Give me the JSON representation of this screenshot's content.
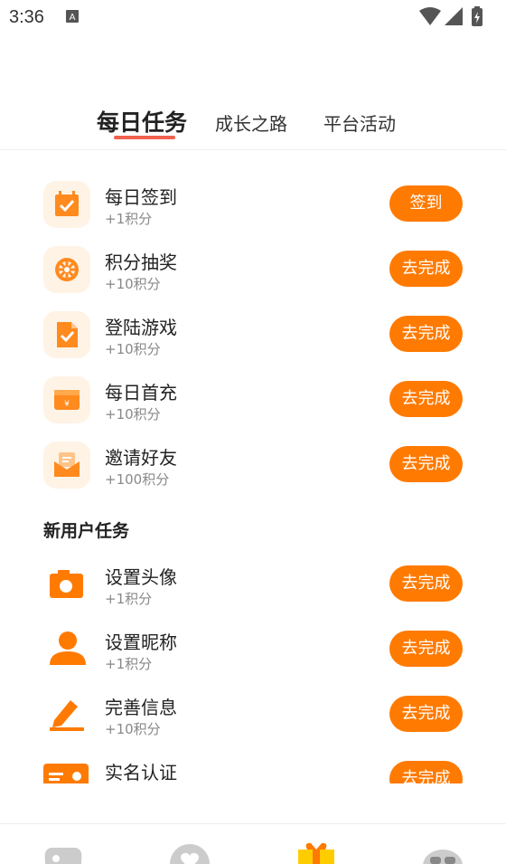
{
  "status_bar": {
    "time": "3:36",
    "icons": [
      "notification-a-icon",
      "wifi-icon",
      "signal-icon",
      "battery-charging-icon"
    ]
  },
  "tabs": [
    {
      "label": "每日任务",
      "active": true
    },
    {
      "label": "成长之路",
      "active": false
    },
    {
      "label": "平台活动",
      "active": false
    }
  ],
  "colors": {
    "accent": "#ff7a00",
    "icon_bg": "#fff3e6",
    "tab_underline": "#f0604f"
  },
  "daily_tasks": [
    {
      "title": "每日签到",
      "points": "+1积分",
      "button": "签到",
      "icon": "calendar-check-icon"
    },
    {
      "title": "积分抽奖",
      "points": "+10积分",
      "button": "去完成",
      "icon": "wheel-icon"
    },
    {
      "title": "登陆游戏",
      "points": "+10积分",
      "button": "去完成",
      "icon": "document-check-icon"
    },
    {
      "title": "每日首充",
      "points": "+10积分",
      "button": "去完成",
      "icon": "wallet-yen-icon"
    },
    {
      "title": "邀请好友",
      "points": "+100积分",
      "button": "去完成",
      "icon": "envelope-icon"
    }
  ],
  "new_user_section": {
    "title": "新用户任务",
    "tasks": [
      {
        "title": "设置头像",
        "points": "+1积分",
        "button": "去完成",
        "icon": "camera-icon"
      },
      {
        "title": "设置昵称",
        "points": "+1积分",
        "button": "去完成",
        "icon": "person-icon"
      },
      {
        "title": "完善信息",
        "points": "+10积分",
        "button": "去完成",
        "icon": "pencil-icon"
      },
      {
        "title": "实名认证",
        "points": "",
        "button": "去完成",
        "icon": "id-card-icon"
      }
    ]
  },
  "bottom_nav": [
    {
      "icon": "gamepad-icon",
      "active": false
    },
    {
      "icon": "heart-icon",
      "active": false
    },
    {
      "icon": "gift-icon",
      "active": true
    },
    {
      "icon": "mascot-icon",
      "active": false
    }
  ]
}
